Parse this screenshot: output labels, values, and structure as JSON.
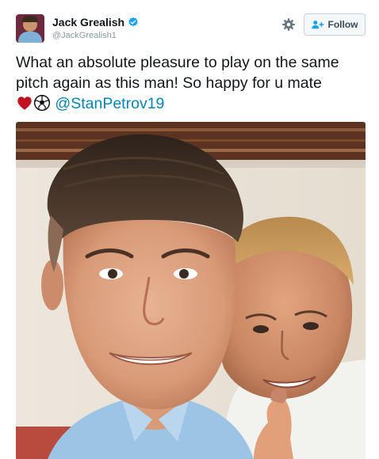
{
  "tweet": {
    "author": {
      "display_name": "Jack Grealish",
      "handle": "@JackGrealish1",
      "verified": true
    },
    "follow_label": "Follow",
    "text_lines": [
      "What an absolute pleasure to play on the same",
      "pitch again as this man! So happy for u mate"
    ],
    "emojis": [
      "heart-emoji",
      "soccer-ball-emoji"
    ],
    "mention": "@StanPetrov19",
    "colors": {
      "accent": "#0084b4",
      "verified_badge": "#1da1f2",
      "heart": "#c1121f"
    }
  }
}
